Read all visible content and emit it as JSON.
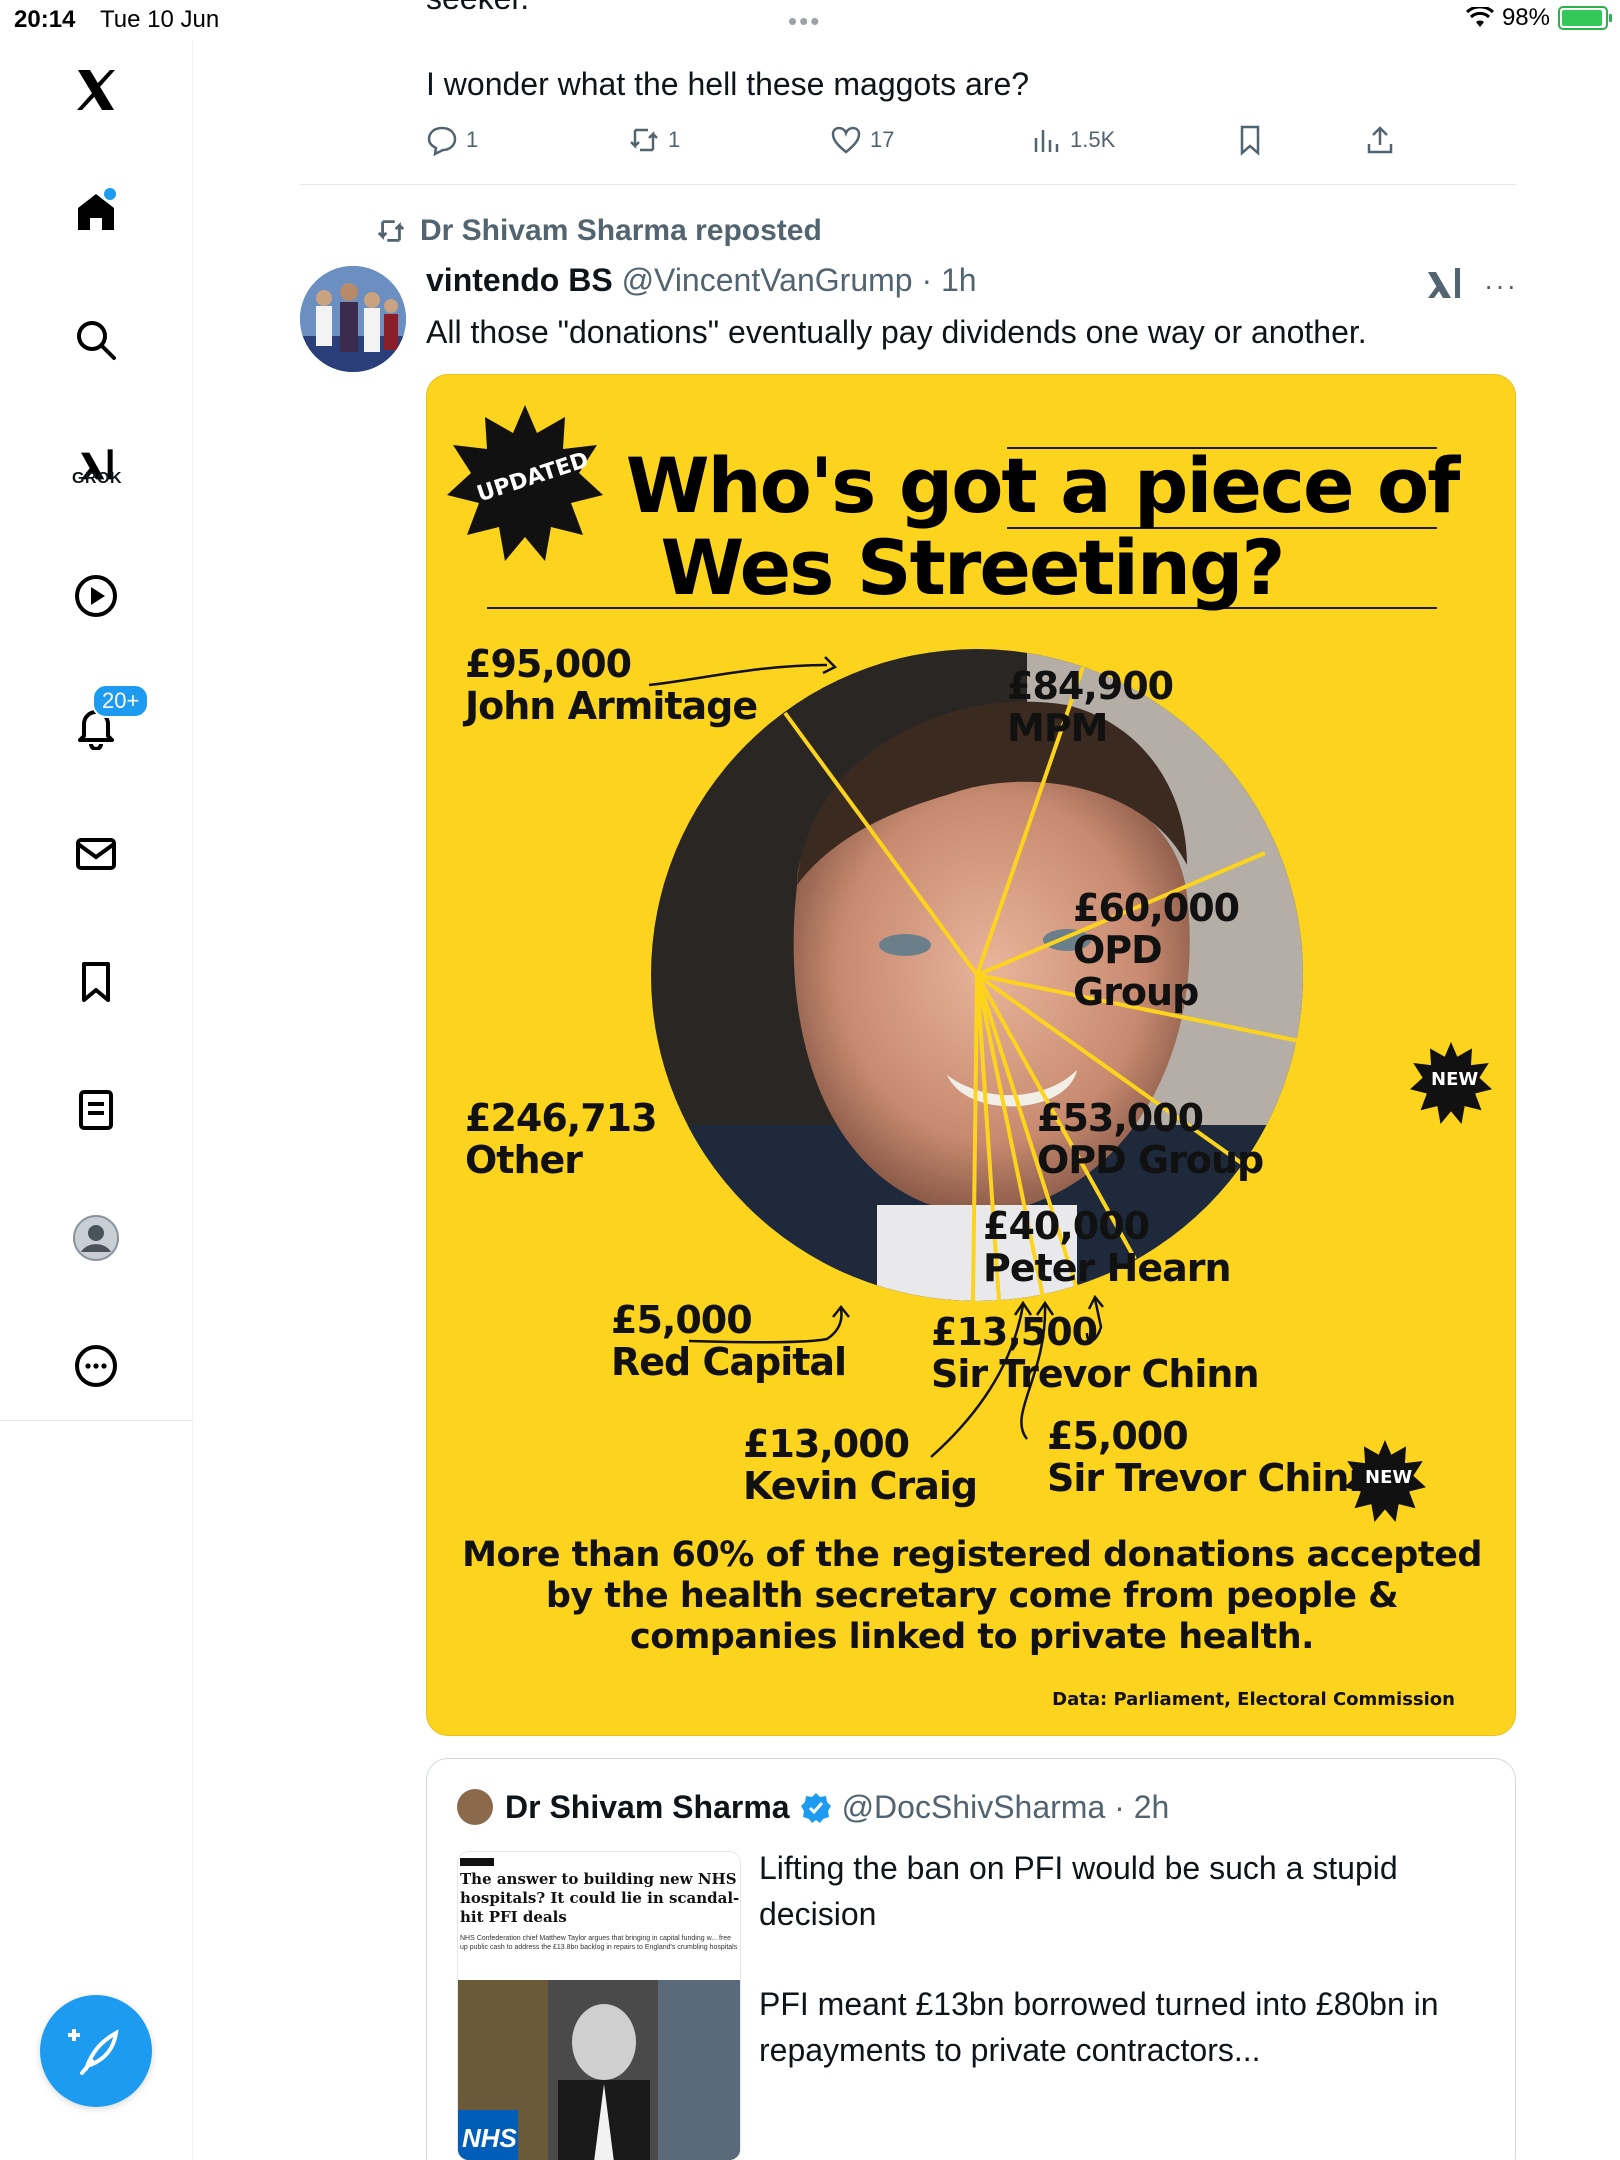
{
  "status_bar": {
    "time": "20:14",
    "date": "Tue 10 Jun",
    "battery": "98%"
  },
  "sidebar": {
    "items": [
      {
        "name": "home",
        "icon": "home-icon"
      },
      {
        "name": "search",
        "icon": "search-icon"
      },
      {
        "name": "grok",
        "icon": "grok-icon",
        "label": "GROK"
      },
      {
        "name": "video",
        "icon": "play-icon"
      },
      {
        "name": "notifications",
        "icon": "bell-icon",
        "badge": "20+"
      },
      {
        "name": "messages",
        "icon": "mail-icon"
      },
      {
        "name": "bookmarks",
        "icon": "bookmark-icon"
      },
      {
        "name": "lists",
        "icon": "list-icon"
      },
      {
        "name": "profile",
        "icon": "profile-icon"
      },
      {
        "name": "more",
        "icon": "more-icon"
      }
    ],
    "compose_icon": "compose-icon"
  },
  "prev_tweet": {
    "partial_text": "seeker.",
    "text": "I wonder what the hell these maggots are?",
    "replies": "1",
    "reposts": "1",
    "likes": "17",
    "views": "1.5K"
  },
  "tweet": {
    "repost_label": "Dr Shivam Sharma reposted",
    "author_name": "vintendo BS",
    "meta": "@VincentVanGrump · 1h",
    "body": "All those \"donations\" eventually pay dividends one way or another."
  },
  "poster": {
    "badge_updated": "UPDATED",
    "title_line1": "Who's got a piece of",
    "title_line2": "Wes Streeting?",
    "labels": {
      "armitage_amount": "£95,000",
      "armitage_name": "John Armitage",
      "mpm_amount": "£84,900",
      "mpm_name": "MPM",
      "opd1_amount": "£60,000",
      "opd1_name_a": "OPD",
      "opd1_name_b": "Group",
      "opd2_amount": "£53,000",
      "opd2_name": "OPD Group",
      "hearn_amount": "£40,000",
      "hearn_name": "Peter Hearn",
      "chinn1_amount": "£13,500",
      "chinn1_name": "Sir Trevor Chinn",
      "chinn2_amount": "£5,000",
      "chinn2_name": "Sir Trevor Chinn",
      "craig_amount": "£13,000",
      "craig_name": "Kevin Craig",
      "red_amount": "£5,000",
      "red_name": "Red Capital",
      "other_amount": "£246,713",
      "other_name": "Other"
    },
    "badge_new": "NEW",
    "caption_l1": "More than 60% of the registered donations accepted",
    "caption_l2": "by the health secretary come from people &",
    "caption_l3": "companies linked to private health.",
    "source": "Data: Parliament, Electoral Commission",
    "colors": {
      "background": "#fdd41d",
      "lines": "#fdd41d",
      "text": "#111111"
    }
  },
  "chart_data": {
    "type": "pie",
    "title": "Who's got a piece of Wes Streeting?",
    "categories": [
      "John Armitage",
      "MPM",
      "OPD Group",
      "OPD Group",
      "Peter Hearn",
      "Sir Trevor Chinn",
      "Sir Trevor Chinn",
      "Kevin Craig",
      "Red Capital",
      "Other"
    ],
    "values": [
      95000,
      84900,
      60000,
      53000,
      40000,
      13500,
      5000,
      13000,
      5000,
      246713
    ],
    "unit": "£"
  },
  "quote": {
    "author_name": "Dr Shivam Sharma",
    "meta": "@DocShivSharma · 2h",
    "thumb_headline": "The answer to building new NHS hospitals? It could lie in scandal-hit PFI deals",
    "thumb_sub": "NHS Confederation chief Matthew Taylor argues that bringing in capital funding w... free up public cash to address the £13.8bn backlog in repairs to England's crumbling hospitals",
    "thumb_logo": "NHS",
    "text_p1": "Lifting the ban on PFI would be such a stupid decision",
    "text_p2": "PFI meant £13bn borrowed turned into £80bn in repayments to private contractors..."
  }
}
